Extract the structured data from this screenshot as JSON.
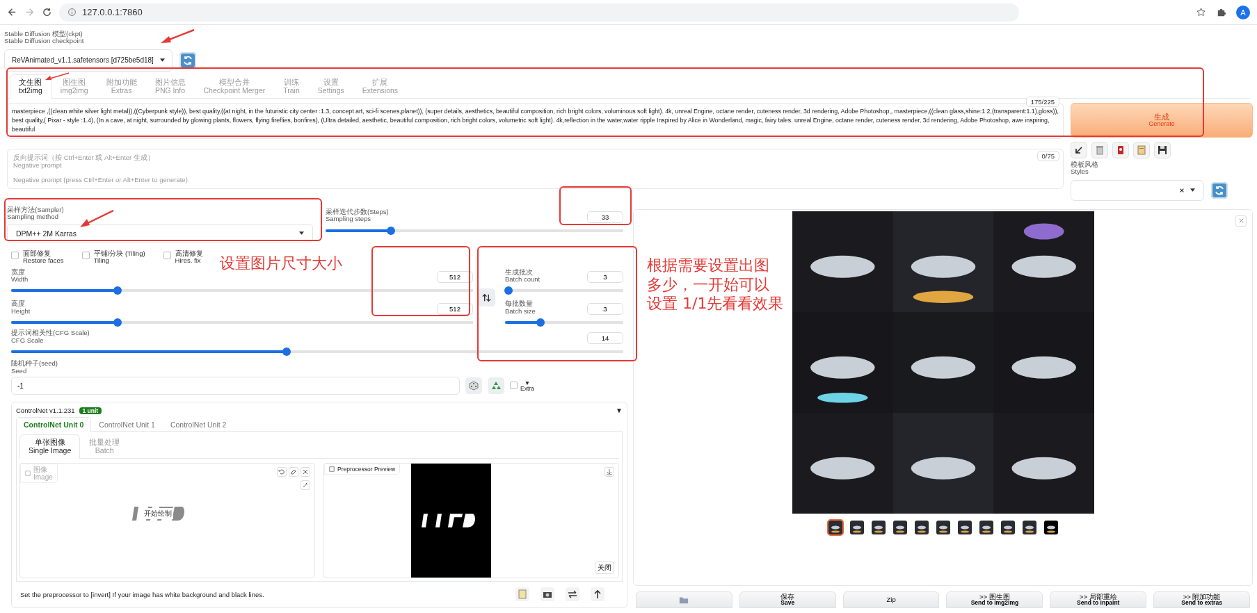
{
  "browser": {
    "url": "127.0.0.1:7860",
    "avatar": "A"
  },
  "checkpoint": {
    "label_zh": "Stable Diffusion 模型(ckpt)",
    "label_en": "Stable Diffusion checkpoint",
    "value": "ReVAnimated_v1.1.safetensors [d725be5d18]"
  },
  "tabs": [
    {
      "zh": "文生图",
      "en": "txt2img",
      "selected": true
    },
    {
      "zh": "图生图",
      "en": "img2img",
      "selected": false
    },
    {
      "zh": "附加功能",
      "en": "Extras",
      "selected": false
    },
    {
      "zh": "图片信息",
      "en": "PNG Info",
      "selected": false
    },
    {
      "zh": "模型合并",
      "en": "Checkpoint Merger",
      "selected": false
    },
    {
      "zh": "训练",
      "en": "Train",
      "selected": false
    },
    {
      "zh": "设置",
      "en": "Settings",
      "selected": false
    },
    {
      "zh": "扩展",
      "en": "Extensions",
      "selected": false
    }
  ],
  "prompt": {
    "value": "masterpiece ,((clean white silver light metal)),((Cyberpunk style)), best quality,((at night, in the futuristic city center :1.3, concept art, sci-fi scenes,planet)), (super details, aesthetics, beautiful composition, rich bright colors, voluminous soft light). 4k, unreal Engine, octane render, cuteness render, 3d rendering, Adobe Photoshop,, masterpiece,((clean glass,shine:1.2,(transparent:1.1),gloss)), best quality,( Pixar - style :1.4), (In a cave, at night, surrounded by glowing plants, flowers, flying fireflies, bonfires), (Ultra detailed, aesthetic, beautiful composition, rich bright colors, volumetric soft light). 4k,reflection in the water,water ripple Inspired by Alice in Wonderland, magic, fairy tales. unreal Engine, octane render, cuteness render, 3d rendering, Adobe Photoshop, awe inspiring, beautiful",
    "counter": "175/225"
  },
  "negative": {
    "label_zh": "反向提示词（按 Ctrl+Enter 或 Alt+Enter 生成）",
    "label_en": "Negative prompt",
    "placeholder": "Negative prompt (press Ctrl+Enter or Alt+Enter to generate)",
    "counter": "0/75"
  },
  "generate": {
    "zh": "生成",
    "en": "Generate"
  },
  "styles": {
    "zh": "模板风格",
    "en": "Styles"
  },
  "sampler": {
    "zh": "采样方法(Sampler)",
    "en": "Sampling method",
    "value": "DPM++ 2M Karras"
  },
  "steps": {
    "zh": "采样迭代步数(Steps)",
    "en": "Sampling steps",
    "value": "33",
    "level": 0.22
  },
  "checkboxes": [
    {
      "zh": "面部修复",
      "en": "Restore faces",
      "checked": false
    },
    {
      "zh": "平铺/分块 (Tiling)",
      "en": "Tiling",
      "checked": false
    },
    {
      "zh": "高清修复",
      "en": "Hires. fix",
      "checked": false
    }
  ],
  "width": {
    "zh": "宽度",
    "en": "Width",
    "value": "512",
    "level": 0.23
  },
  "height": {
    "zh": "高度",
    "en": "Height",
    "value": "512",
    "level": 0.23
  },
  "batch_count": {
    "zh": "生成批次",
    "en": "Batch count",
    "value": "3",
    "level": 0.03
  },
  "batch_size": {
    "zh": "每批数量",
    "en": "Batch size",
    "value": "3",
    "level": 0.3
  },
  "cfg": {
    "zh": "提示词相关性(CFG Scale)",
    "en": "CFG Scale",
    "value": "14",
    "level": 0.45
  },
  "seed": {
    "zh": "随机种子(seed)",
    "en": "Seed",
    "value": "-1",
    "extra_mark": "▼",
    "extra_label": "Extra",
    "extra_checked": false
  },
  "controlnet": {
    "title": "ControlNet v1.1.231",
    "badge": "1 unit",
    "toggle": "▼",
    "tabs": [
      {
        "label": "ControlNet Unit 0",
        "selected": true
      },
      {
        "label": "ControlNet Unit 1",
        "selected": false
      },
      {
        "label": "ControlNet Unit 2",
        "selected": false
      }
    ],
    "subtabs": [
      {
        "zh": "单张图像",
        "en": "Single Image",
        "selected": true
      },
      {
        "zh": "批量处理",
        "en": "Batch",
        "selected": false
      }
    ],
    "image_zh": "图像",
    "image_en": "Image",
    "canvas_hint": "开始绘制",
    "preview_label": "Preprocessor Preview",
    "close": "关闭",
    "hint": "Set the preprocessor to [invert] If your image has white background and black lines."
  },
  "gallery": {
    "thumbnails": [
      {
        "selected": true
      },
      {
        "selected": false
      },
      {
        "selected": false
      },
      {
        "selected": false
      },
      {
        "selected": false
      },
      {
        "selected": false
      },
      {
        "selected": false
      },
      {
        "selected": false
      },
      {
        "selected": false
      },
      {
        "selected": false
      },
      {
        "selected": false
      }
    ]
  },
  "actions": [
    {
      "kind": "folder"
    },
    {
      "kind": "text",
      "zh": "保存",
      "en": "Save"
    },
    {
      "kind": "text",
      "zh": "Zip"
    },
    {
      "kind": "text",
      "zh": ">> 图生图",
      "en": "Send to img2img"
    },
    {
      "kind": "text",
      "zh": ">> 局部重绘",
      "en": "Send to inpaint"
    },
    {
      "kind": "text",
      "zh": ">> 附加功能",
      "en": "Send to extras"
    }
  ],
  "annotations": {
    "size_note": "设置图片尺寸大小",
    "batch_note": [
      "根据需要设置出图",
      "多少，一开始可以",
      "设置 1/1先看看效果"
    ]
  }
}
